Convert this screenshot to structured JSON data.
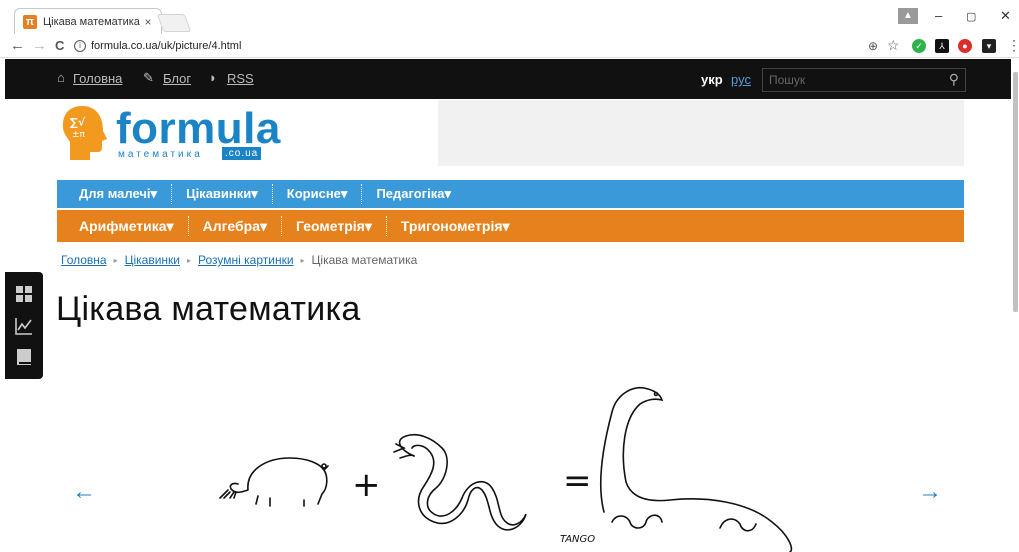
{
  "browser": {
    "tab_title": "Цікава математика | Ро:",
    "tab_favicon": "π",
    "tab_close": "×",
    "url": "formula.co.ua/uk/picture/4.html",
    "back": "←",
    "forward": "→",
    "reload": "C",
    "info": "i",
    "minimize": "–",
    "restore": "▢",
    "close": "✕",
    "zoom_icon": "⊕",
    "star": "☆",
    "menu": "⋮"
  },
  "topnav": {
    "home": "Головна",
    "blog": "Блог",
    "rss": "RSS",
    "lang_ukr": "укр",
    "lang_rus": "рус",
    "search_placeholder": "Пошук"
  },
  "logo": {
    "word": "formula",
    "sub": "математика",
    "domain": ".co.ua"
  },
  "menu_primary": [
    "Для малечі▾",
    "Цікавинки▾",
    "Корисне▾",
    "Педагогіка▾"
  ],
  "menu_secondary": [
    "Арифметика▾",
    "Алгебра▾",
    "Геометрія▾",
    "Тригонометрія▾"
  ],
  "breadcrumb": {
    "items": [
      "Головна",
      "Цікавинки",
      "Розумні картинки"
    ],
    "current": "Цікава математика",
    "separator": "▸"
  },
  "page_title": "Цікава математика",
  "picture": {
    "plus": "+",
    "equals": "=",
    "signature": "TANGO",
    "prev_arrow": "←",
    "next_arrow": "→"
  },
  "colors": {
    "menu_blue": "#3a9ad9",
    "menu_orange": "#e6821e",
    "logo_blue": "#1b84c6",
    "logo_orange": "#f29a1f"
  }
}
